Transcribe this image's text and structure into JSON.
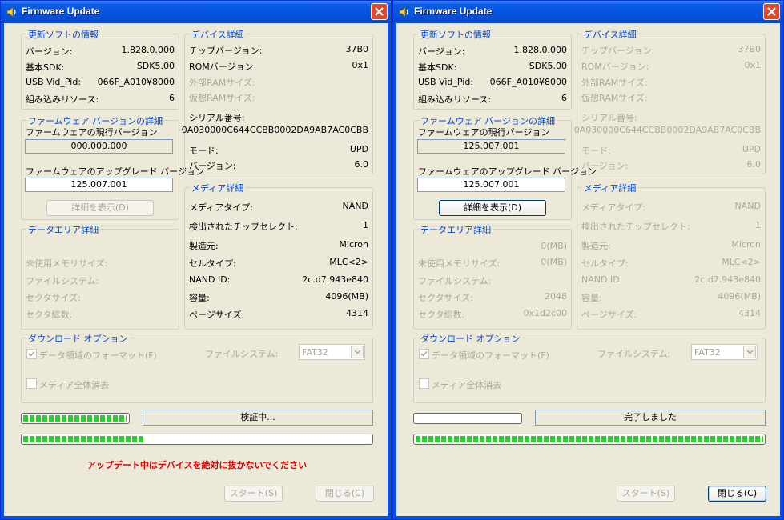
{
  "colors": {
    "title_bar": "#0A50E0",
    "group_title": "#0046D5",
    "warning": "#E00000",
    "progress": "#2FCB2F",
    "disabled": "#ACA899"
  },
  "windows": [
    {
      "title": "Firmware Update",
      "sw": {
        "title": "更新ソフトの情報",
        "version_label": "バージョン:",
        "version": "1.828.0.000",
        "sdk_label": "基本SDK:",
        "sdk": "SDK5.00",
        "vidpid_label": "USB Vid_Pid:",
        "vidpid": "066F_A010¥8000",
        "res_label": "組み込みリソース:",
        "res": "6"
      },
      "dev": {
        "title": "デバイス詳細",
        "chip_label": "チップバージョン:",
        "chip": "37B0",
        "rom_label": "ROMバージョン:",
        "rom": "0x1",
        "extram_label": "外部RAMサイズ:",
        "vram_label": "仮想RAMサイズ:",
        "serial_label": "シリアル番号:",
        "serial": "0A030000C644CCBB0002DA9AB7AC0CBB",
        "mode_label": "モード:",
        "mode": "UPD",
        "ver_label": "バージョン:",
        "ver": "6.0"
      },
      "fw": {
        "title": "ファームウェア バージョンの詳細",
        "current_label": "ファームウェアの現行バージョン",
        "current": "000.000.000",
        "upgrade_label": "ファームウェアのアップグレード バージョン",
        "upgrade": "125.007.001",
        "details_button": "詳細を表示(D)"
      },
      "data": {
        "title": "データエリア詳細",
        "row0": "",
        "row0_value": "",
        "unused_label": "未使用メモリサイズ:",
        "unused": "",
        "fs_label": "ファイルシステム:",
        "fs": "",
        "sector_label": "セクタサイズ:",
        "sector": "",
        "sectors_label": "セクタ総数:",
        "sectors": ""
      },
      "media": {
        "title": "メディア詳細",
        "type_label": "メディアタイプ:",
        "type": "NAND",
        "cs_label": "検出されたチップセレクト:",
        "cs": "1",
        "maker_label": "製造元:",
        "maker": "Micron",
        "cell_label": "セルタイプ:",
        "cell": "MLC<2>",
        "nandid_label": "NAND ID:",
        "nandid": "2c.d7.943e840",
        "cap_label": "容量:",
        "cap": "4096(MB)",
        "page_label": "ページサイズ:",
        "page": "4314"
      },
      "dl": {
        "title": "ダウンロード オプション",
        "format_label": "データ領域のフォーマット(F)",
        "format_checked": true,
        "fs_label": "ファイルシステム:",
        "fs_value": "FAT32",
        "erase_label": "メディア全体消去",
        "erase_checked": false
      },
      "progress": {
        "small_fraction": 0.99,
        "big_fraction": 0.35,
        "status": "検証中..."
      },
      "warning": "アップデート中はデバイスを絶対に抜かないでください",
      "buttons": {
        "start": "スタート(S)",
        "close": "閉じる(C)"
      }
    },
    {
      "title": "Firmware Update",
      "sw": {
        "title": "更新ソフトの情報",
        "version_label": "バージョン:",
        "version": "1.828.0.000",
        "sdk_label": "基本SDK:",
        "sdk": "SDK5.00",
        "vidpid_label": "USB Vid_Pid:",
        "vidpid": "066F_A010¥8000",
        "res_label": "組み込みリソース:",
        "res": "6"
      },
      "dev": {
        "title": "デバイス詳細",
        "chip_label": "チップバージョン:",
        "chip": "37B0",
        "rom_label": "ROMバージョン:",
        "rom": "0x1",
        "extram_label": "外部RAMサイズ:",
        "vram_label": "仮想RAMサイズ:",
        "serial_label": "シリアル番号:",
        "serial": "0A030000C644CCBB0002DA9AB7AC0CBB",
        "mode_label": "モード:",
        "mode": "UPD",
        "ver_label": "バージョン:",
        "ver": "6.0"
      },
      "fw": {
        "title": "ファームウェア バージョンの詳細",
        "current_label": "ファームウェアの現行バージョン",
        "current": "125.007.001",
        "upgrade_label": "ファームウェアのアップグレード バージョン",
        "upgrade": "125.007.001",
        "details_button": "詳細を表示(D)"
      },
      "data": {
        "title": "データエリア詳細",
        "row0": "",
        "row0_value": "0(MB)",
        "unused_label": "未使用メモリサイズ:",
        "unused": "0(MB)",
        "fs_label": "ファイルシステム:",
        "fs": "",
        "sector_label": "セクタサイズ:",
        "sector": "2048",
        "sectors_label": "セクタ総数:",
        "sectors": "0x1d2c00"
      },
      "media": {
        "title": "メディア詳細",
        "type_label": "メディアタイプ:",
        "type": "NAND",
        "cs_label": "検出されたチップセレクト:",
        "cs": "1",
        "maker_label": "製造元:",
        "maker": "Micron",
        "cell_label": "セルタイプ:",
        "cell": "MLC<2>",
        "nandid_label": "NAND ID:",
        "nandid": "2c.d7.943e840",
        "cap_label": "容量:",
        "cap": "4096(MB)",
        "page_label": "ページサイズ:",
        "page": "4314"
      },
      "dl": {
        "title": "ダウンロード オプション",
        "format_label": "データ領域のフォーマット(F)",
        "format_checked": true,
        "fs_label": "ファイルシステム:",
        "fs_value": "FAT32",
        "erase_label": "メディア全体消去",
        "erase_checked": false
      },
      "progress": {
        "small_fraction": 0.0,
        "big_fraction": 1.0,
        "status": "完了しました"
      },
      "warning": "",
      "buttons": {
        "start": "スタート(S)",
        "close": "閉じる(C)"
      }
    }
  ]
}
